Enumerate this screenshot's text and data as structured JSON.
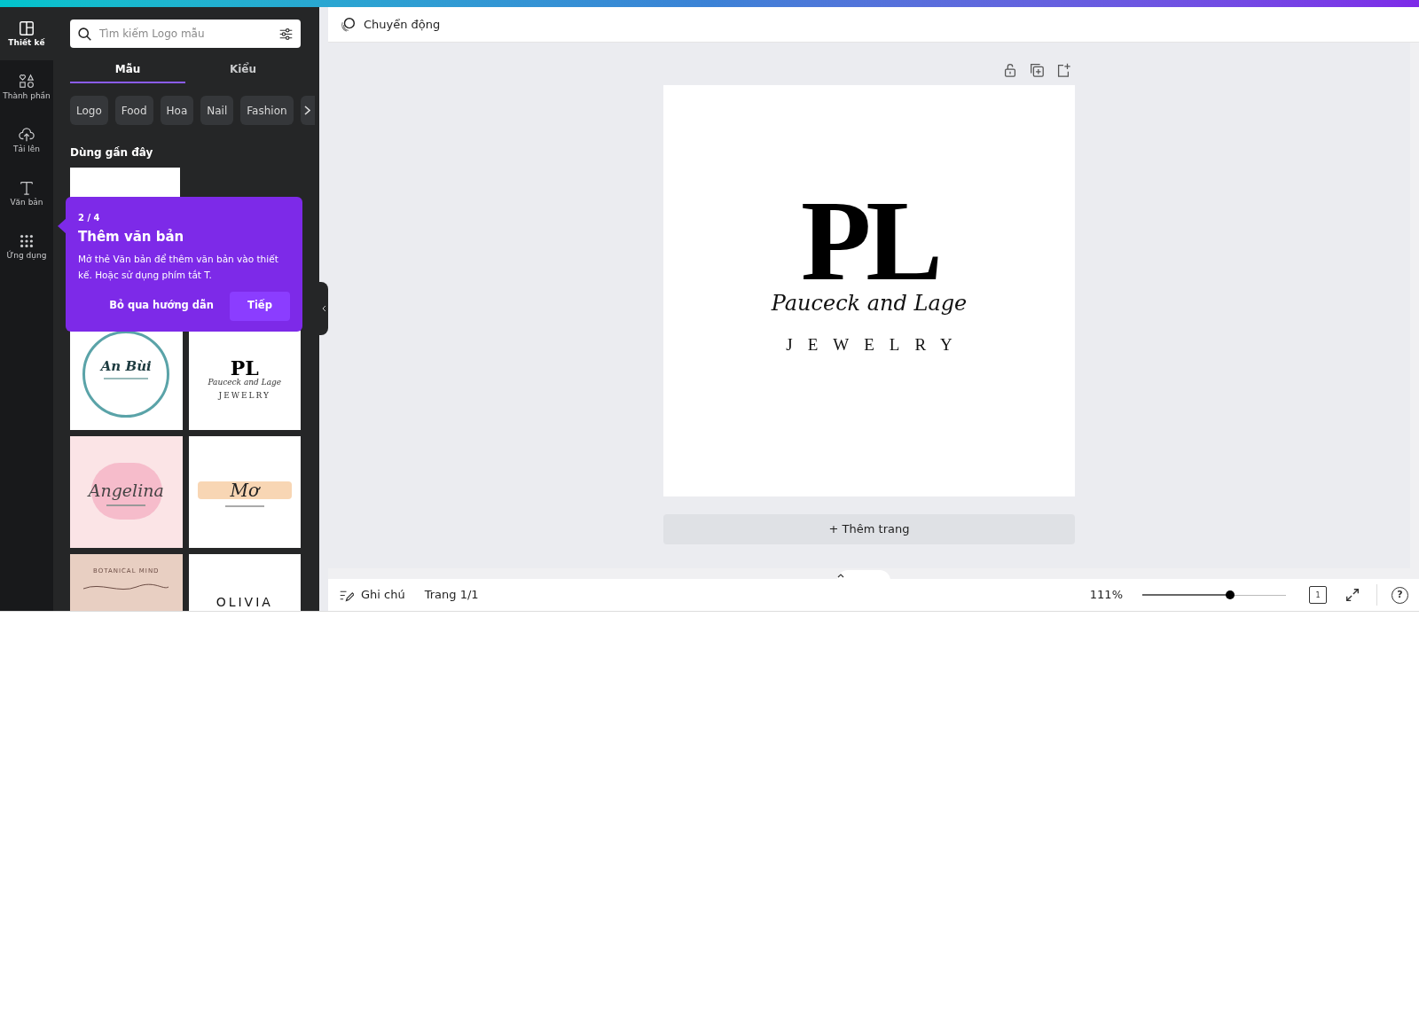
{
  "rail": [
    {
      "kind": "layout",
      "label": "Thiết kế",
      "selected": true
    },
    {
      "kind": "elements",
      "label": "Thành phần",
      "selected": false
    },
    {
      "kind": "upload",
      "label": "Tải lên",
      "selected": false
    },
    {
      "kind": "text",
      "label": "Văn bản",
      "selected": false
    },
    {
      "kind": "apps",
      "label": "Ứng dụng",
      "selected": false
    }
  ],
  "panel": {
    "search": {
      "placeholder": "Tìm kiếm Logo mẫu"
    },
    "tabs": [
      {
        "label": "Mẫu",
        "selected": true
      },
      {
        "label": "Kiểu",
        "selected": false
      }
    ],
    "chips": [
      "Logo",
      "Food",
      "Hoa",
      "Nail",
      "Fashion"
    ],
    "recent_heading": "Dùng gần đây",
    "templates": [
      {
        "kind": "circle",
        "texts": [
          "An Bùi"
        ]
      },
      {
        "kind": "monogram",
        "texts": [
          "PL",
          "Pauceck and Lage",
          "JEWELRY"
        ]
      },
      {
        "kind": "watercolor",
        "texts": [
          "Angelina"
        ]
      },
      {
        "kind": "brush",
        "texts": [
          "Mơ"
        ]
      },
      {
        "kind": "botanical",
        "texts": [
          "BOTANICAL MIND"
        ]
      },
      {
        "kind": "wordmark",
        "texts": [
          "OLIVIA"
        ]
      }
    ]
  },
  "tour": {
    "step": "2 / 4",
    "title": "Thêm văn bản",
    "body": "Mở thẻ Văn bản để thêm văn bản vào thiết kế. Hoặc sử dụng phím tắt T.",
    "skip": "Bỏ qua hướng dẫn",
    "next": "Tiếp"
  },
  "toolbar": {
    "animate": "Chuyển động"
  },
  "design": {
    "monogram": "PL",
    "script": "Pauceck and Lage",
    "tagline": "JEWELRY"
  },
  "add_page": "+ Thêm trang",
  "footer": {
    "notes": "Ghi chú",
    "page": "Trang 1/1",
    "zoom": "111%",
    "zoom_slider": {
      "level": 0.61
    },
    "page_count": "1",
    "help": "?"
  }
}
